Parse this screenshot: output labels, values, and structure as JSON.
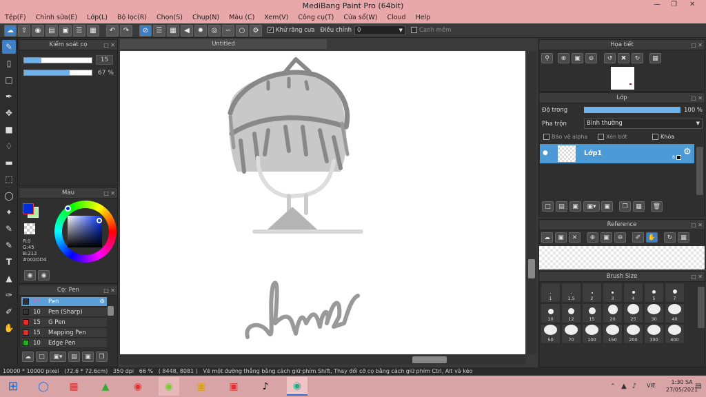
{
  "window": {
    "title": "MediBang Paint Pro (64bit)"
  },
  "menu": [
    "Tệp(F)",
    "Chỉnh sửa(E)",
    "Lớp(L)",
    "Bộ lọc(R)",
    "Chọn(S)",
    "Chụp(N)",
    "Màu (C)",
    "Xem(V)",
    "Công cụ(T)",
    "Cửa sổ(W)",
    "Cloud",
    "Help"
  ],
  "toolbar": {
    "antialias_label": "Khử răng cưa",
    "adjust_label": "Điều chỉnh",
    "adjust_value": "0",
    "smooth_label": "Canh mềm"
  },
  "brush_control": {
    "title": "Kiểm soát cọ",
    "size": "15",
    "size_fraction": 0.25,
    "opacity": "67 %",
    "opacity_fraction": 0.67
  },
  "color_panel": {
    "title": "Màu",
    "r": "R:0",
    "g": "G:45",
    "b": "B:212",
    "hex": "#002DD4",
    "primary": "#002DD4",
    "secondary": "#b3f0a0"
  },
  "brush_panel": {
    "title": "Cọ: Pen",
    "items": [
      {
        "size": "15",
        "name": "Pen",
        "color": "#333333"
      },
      {
        "size": "10",
        "name": "Pen (Sharp)",
        "color": "#333333"
      },
      {
        "size": "15",
        "name": "G Pen",
        "color": "#e23030"
      },
      {
        "size": "15",
        "name": "Mapping Pen",
        "color": "#e23030"
      },
      {
        "size": "10",
        "name": "Edge Pen",
        "color": "#22aa22"
      }
    ]
  },
  "canvas": {
    "tab": "Untitled"
  },
  "navigator": {
    "title": "Họa tiết"
  },
  "layer_panel": {
    "title": "Lớp",
    "opacity_label": "Độ trong",
    "opacity_value": "100 %",
    "opacity_fraction": 1.0,
    "blend_label": "Pha trộn",
    "blend_value": "Bình thường",
    "protect_alpha": "Bảo vệ alpha",
    "clipping": "Xén bớt",
    "lock": "Khóa",
    "layer_name": "Lớp1",
    "layer_num": "8"
  },
  "reference": {
    "title": "Reference"
  },
  "brush_size": {
    "title": "Brush Size",
    "sizes": [
      "1",
      "1.5",
      "2",
      "3",
      "4",
      "5",
      "7",
      "10",
      "12",
      "15",
      "20",
      "25",
      "30",
      "40",
      "50",
      "70",
      "100",
      "150",
      "200",
      "300",
      "400"
    ]
  },
  "status": {
    "dims": "10000 * 10000 pixel",
    "cm": "(72.6 * 72.6cm)",
    "dpi": "350 dpi",
    "zoom": "66 %",
    "coords": "( 8448, 8081 )",
    "hint": "Vẽ một đường thẳng bằng cách giữ phím Shift, Thay đổi cỡ cọ bằng cách giữ phím Ctrl, Alt và kéo"
  },
  "taskbar": {
    "lang": "VIE",
    "time": "1:30 SA",
    "date": "27/05/2021"
  }
}
